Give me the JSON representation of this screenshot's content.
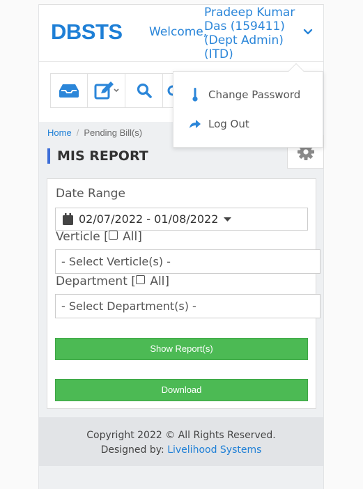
{
  "header": {
    "logo": "DBSTS",
    "welcome": "Welcome,",
    "username": "Pradeep Kumar Das (159411) (Dept Admin) (ITD)"
  },
  "toolbar": {
    "icons": [
      "inbox-icon",
      "edit-icon",
      "search-icon",
      "user-icon"
    ]
  },
  "user_menu": {
    "items": [
      {
        "label": "Change Password",
        "icon": "thermometer-icon"
      },
      {
        "label": "Log Out",
        "icon": "share-arrow-icon"
      }
    ]
  },
  "breadcrumb": {
    "home": "Home",
    "separator": "/",
    "current": "Pending Bill(s)"
  },
  "page_title": "MIS REPORT",
  "form": {
    "date_range_label": "Date Range",
    "date_range_value": "02/07/2022 - 01/08/2022",
    "verticle_label_prefix": "Verticle [",
    "verticle_label_all": "All]",
    "verticle_placeholder": "- Select Verticle(s) -",
    "department_label_prefix": "Department [",
    "department_label_all": "All]",
    "department_placeholder": "- Select Department(s) -",
    "show_report_label": "Show Report(s)",
    "download_label": "Download"
  },
  "footer": {
    "copyright": "Copyright 2022 © All Rights Reserved.",
    "designed_by": "Designed by:",
    "company": "Livelihood Systems"
  },
  "colors": {
    "brand_blue": "#1e7fd6",
    "title_accent": "#3d6ed8",
    "button_green": "#4cba54"
  }
}
